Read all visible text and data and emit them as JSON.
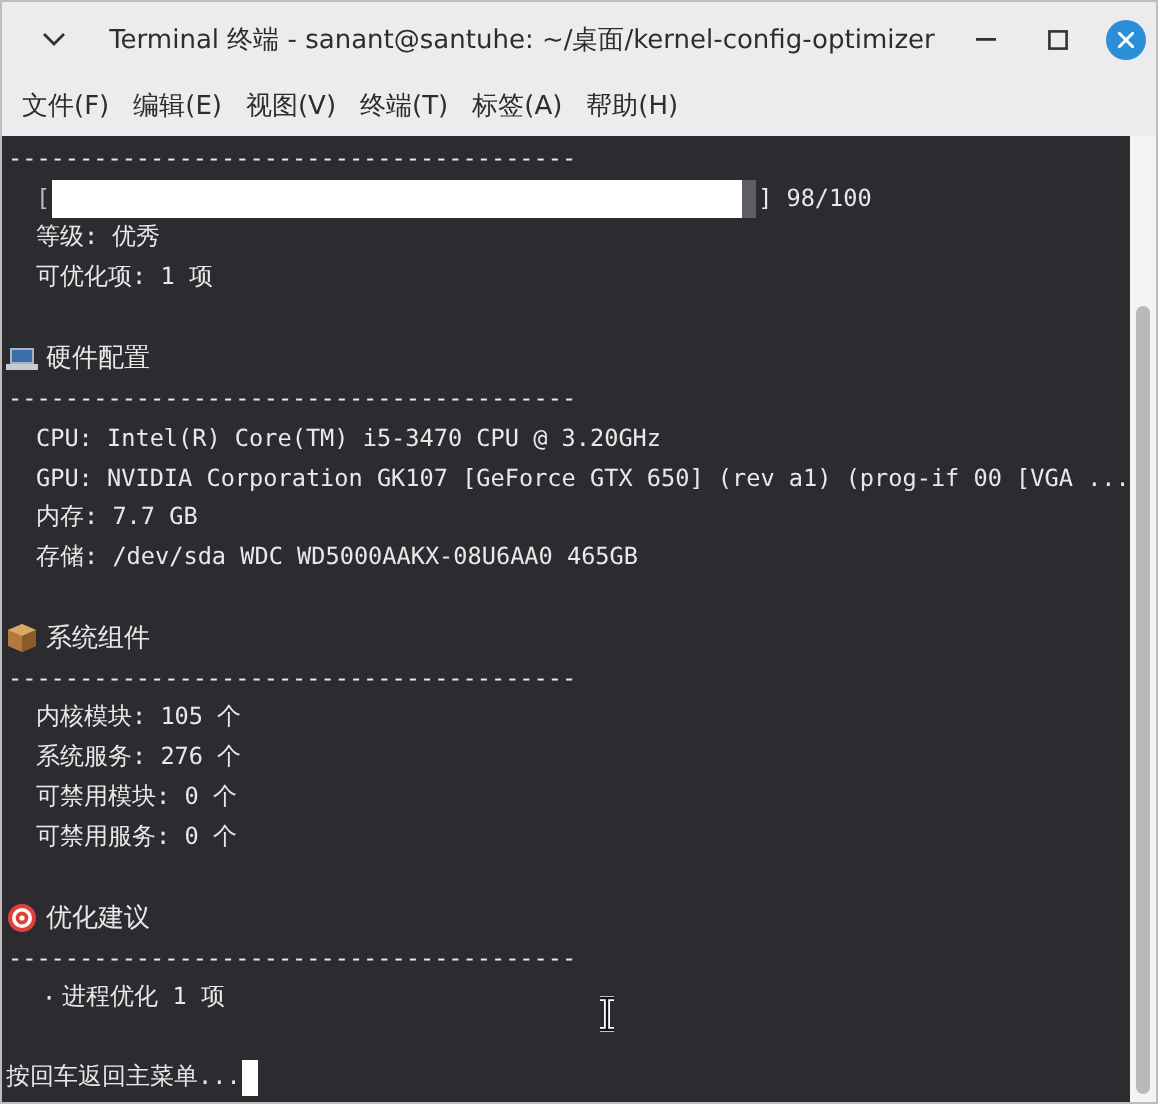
{
  "window": {
    "title": "Terminal 终端 - sanant@santuhe: ~/桌面/kernel-config-optimizer"
  },
  "menu": [
    "文件(F)",
    "编辑(E)",
    "视图(V)",
    "终端(T)",
    "标签(A)",
    "帮助(H)"
  ],
  "lines": [
    {
      "kind": "rule",
      "text": "----------------------------------------"
    },
    {
      "kind": "score",
      "open": "[",
      "close": "]",
      "level": 0.98,
      "text": "98/100"
    },
    {
      "kind": "text",
      "text": "等级: 优秀"
    },
    {
      "kind": "text",
      "text": "可优化项: 1 项"
    },
    {
      "kind": "blank"
    },
    {
      "kind": "heading",
      "text": "硬件配置"
    },
    {
      "kind": "rule",
      "text": "----------------------------------------"
    },
    {
      "kind": "text",
      "text": "CPU: Intel(R) Core(TM) i5-3470 CPU @ 3.20GHz"
    },
    {
      "kind": "text",
      "text": "GPU: NVIDIA Corporation GK107 [GeForce GTX 650] (rev a1) (prog-if 00 [VGA ..."
    },
    {
      "kind": "text",
      "text": "内存: 7.7 GB"
    },
    {
      "kind": "text",
      "text": "存储: /dev/sda WDC WD5000AAKX-08U6AA0 465GB"
    },
    {
      "kind": "blank"
    },
    {
      "kind": "heading",
      "text": "系统组件"
    },
    {
      "kind": "rule",
      "text": "----------------------------------------"
    },
    {
      "kind": "text",
      "text": "内核模块: 105 个"
    },
    {
      "kind": "text",
      "text": "系统服务: 276 个"
    },
    {
      "kind": "text",
      "text": "可禁用模块: 0 个"
    },
    {
      "kind": "text",
      "text": "可禁用服务: 0 个"
    },
    {
      "kind": "blank"
    },
    {
      "kind": "heading",
      "text": "优化建议"
    },
    {
      "kind": "rule",
      "text": "----------------------------------------"
    },
    {
      "kind": "bullet",
      "mark": "·",
      "text": "进程优化 1 项"
    },
    {
      "kind": "blank"
    },
    {
      "kind": "prompt",
      "text": "按回车返回主菜单..."
    }
  ]
}
